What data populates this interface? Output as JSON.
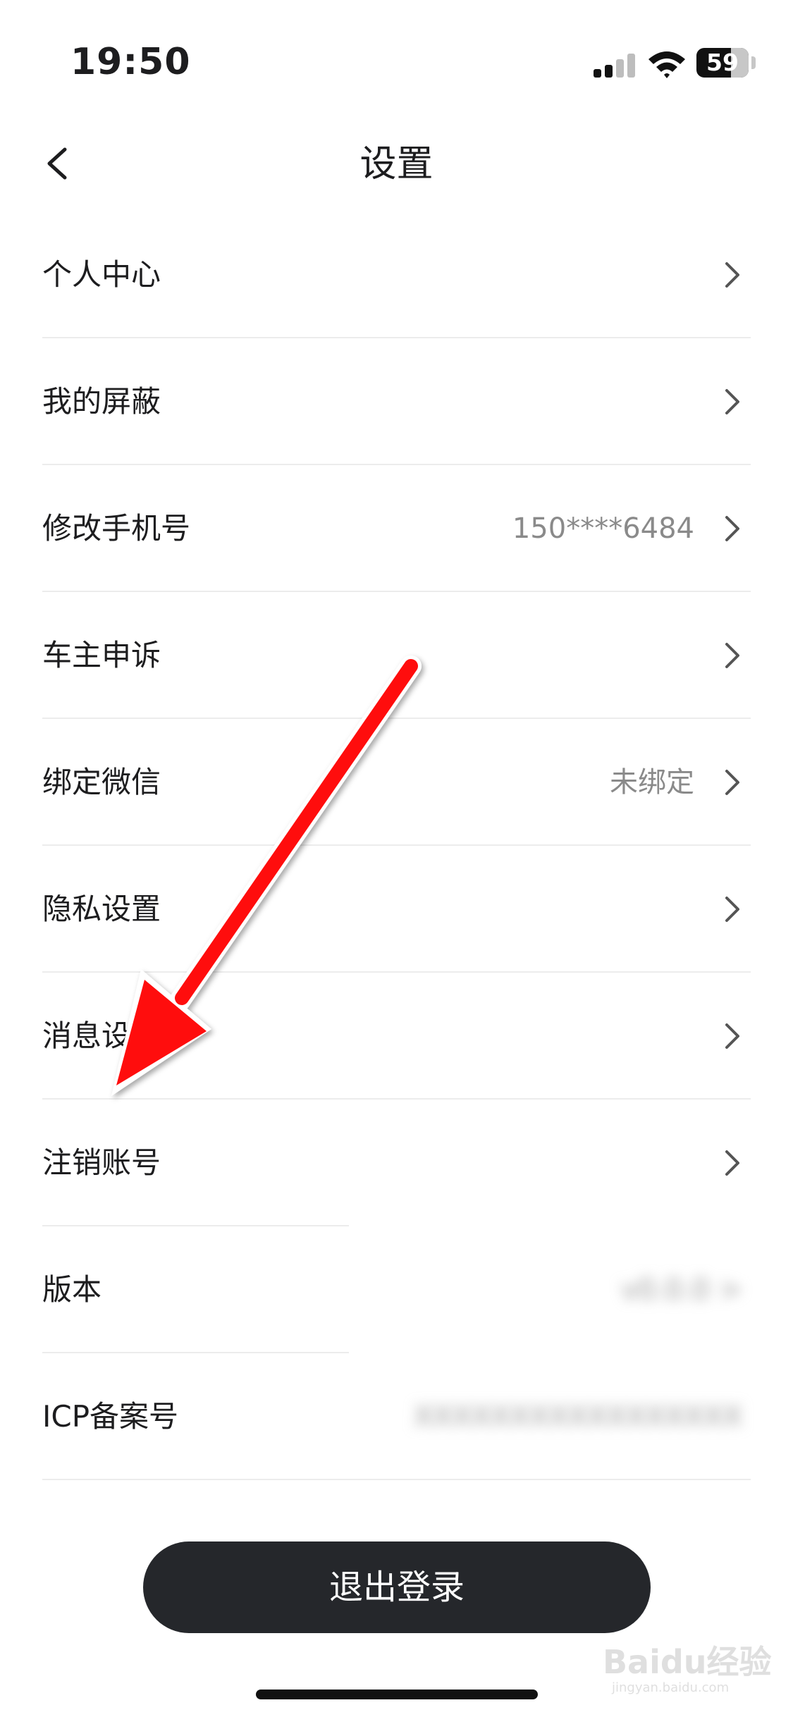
{
  "status_bar": {
    "time": "19:50",
    "battery": "59"
  },
  "nav": {
    "title": "设置"
  },
  "rows": [
    {
      "label": "个人中心",
      "value": ""
    },
    {
      "label": "我的屏蔽",
      "value": ""
    },
    {
      "label": "修改手机号",
      "value": "150****6484"
    },
    {
      "label": "车主申诉",
      "value": ""
    },
    {
      "label": "绑定微信",
      "value": "未绑定"
    },
    {
      "label": "隐私设置",
      "value": ""
    },
    {
      "label": "消息设",
      "value": ""
    },
    {
      "label": "注销账号",
      "value": ""
    },
    {
      "label": "版本",
      "value": ""
    },
    {
      "label": "ICP备案号",
      "value": ""
    }
  ],
  "logout": {
    "label": "退出登录"
  },
  "watermark": {
    "brand": "Baidu经验",
    "url": "jingyan.baidu.com"
  },
  "colors": {
    "arrow": "#ff1010",
    "button_bg": "#25272b",
    "divider": "#ececec",
    "secondary_text": "#8a8a8a"
  }
}
